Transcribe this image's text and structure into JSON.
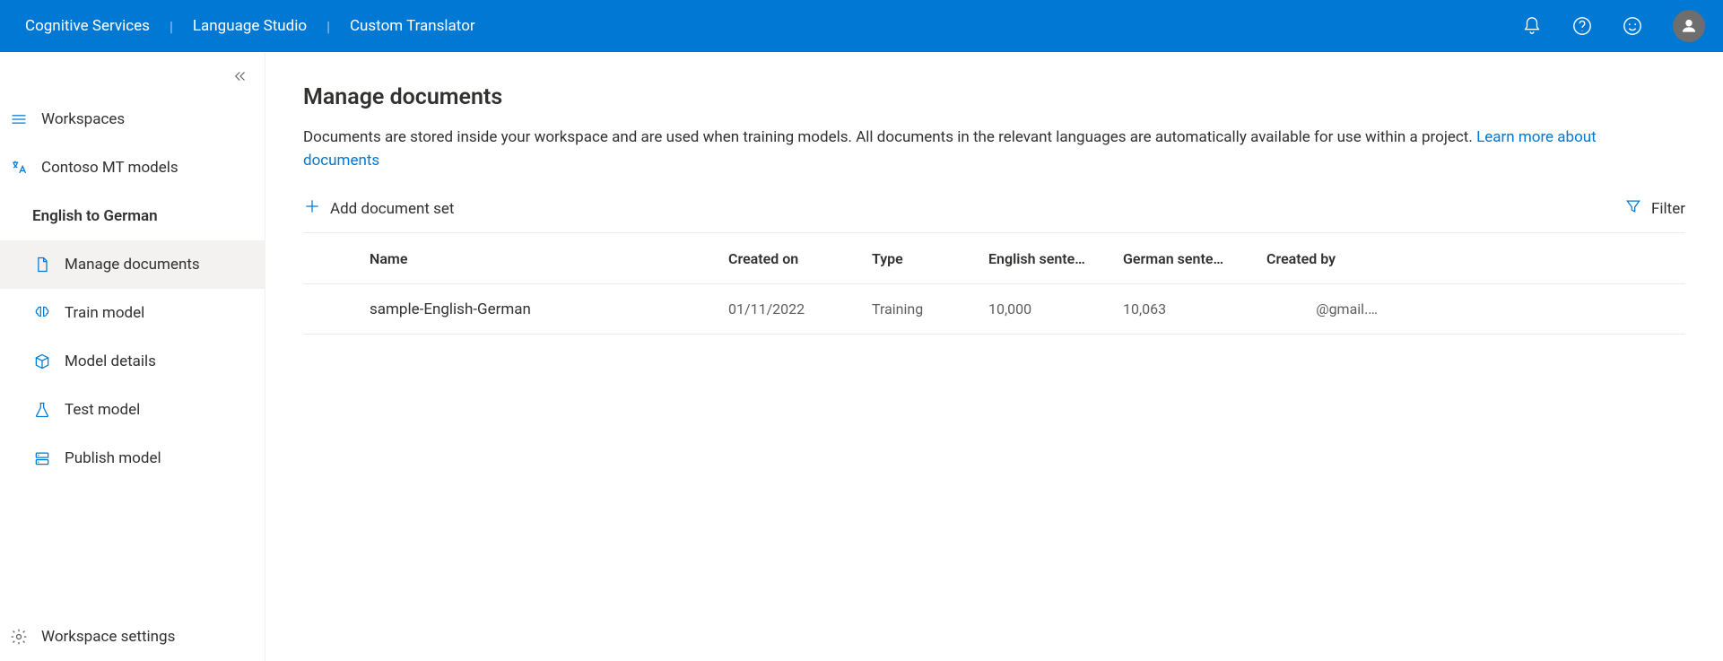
{
  "header": {
    "brand": "Cognitive Services",
    "product": "Language Studio",
    "app": "Custom Translator"
  },
  "sidebar": {
    "collapse_title": "Collapse",
    "workspaces": "Workspaces",
    "workspace_name": "Contoso MT models",
    "project_name": "English to German",
    "items": {
      "manage_documents": "Manage documents",
      "train_model": "Train model",
      "model_details": "Model details",
      "test_model": "Test model",
      "publish_model": "Publish model"
    },
    "workspace_settings": "Workspace settings"
  },
  "main": {
    "title": "Manage documents",
    "description": "Documents are stored inside your workspace and are used when training models. All documents in the relevant languages are automatically available for use within a project. ",
    "learn_more": "Learn more about documents",
    "toolbar": {
      "add": "Add document set",
      "filter": "Filter"
    },
    "table": {
      "columns": {
        "name": "Name",
        "created_on": "Created on",
        "type": "Type",
        "english": "English sente…",
        "german": "German sente…",
        "created_by": "Created by"
      },
      "rows": [
        {
          "name": "sample-English-German",
          "created_on": "01/11/2022",
          "type": "Training",
          "english": "10,000",
          "german": "10,063",
          "created_by": "@gmail.…"
        }
      ]
    }
  }
}
